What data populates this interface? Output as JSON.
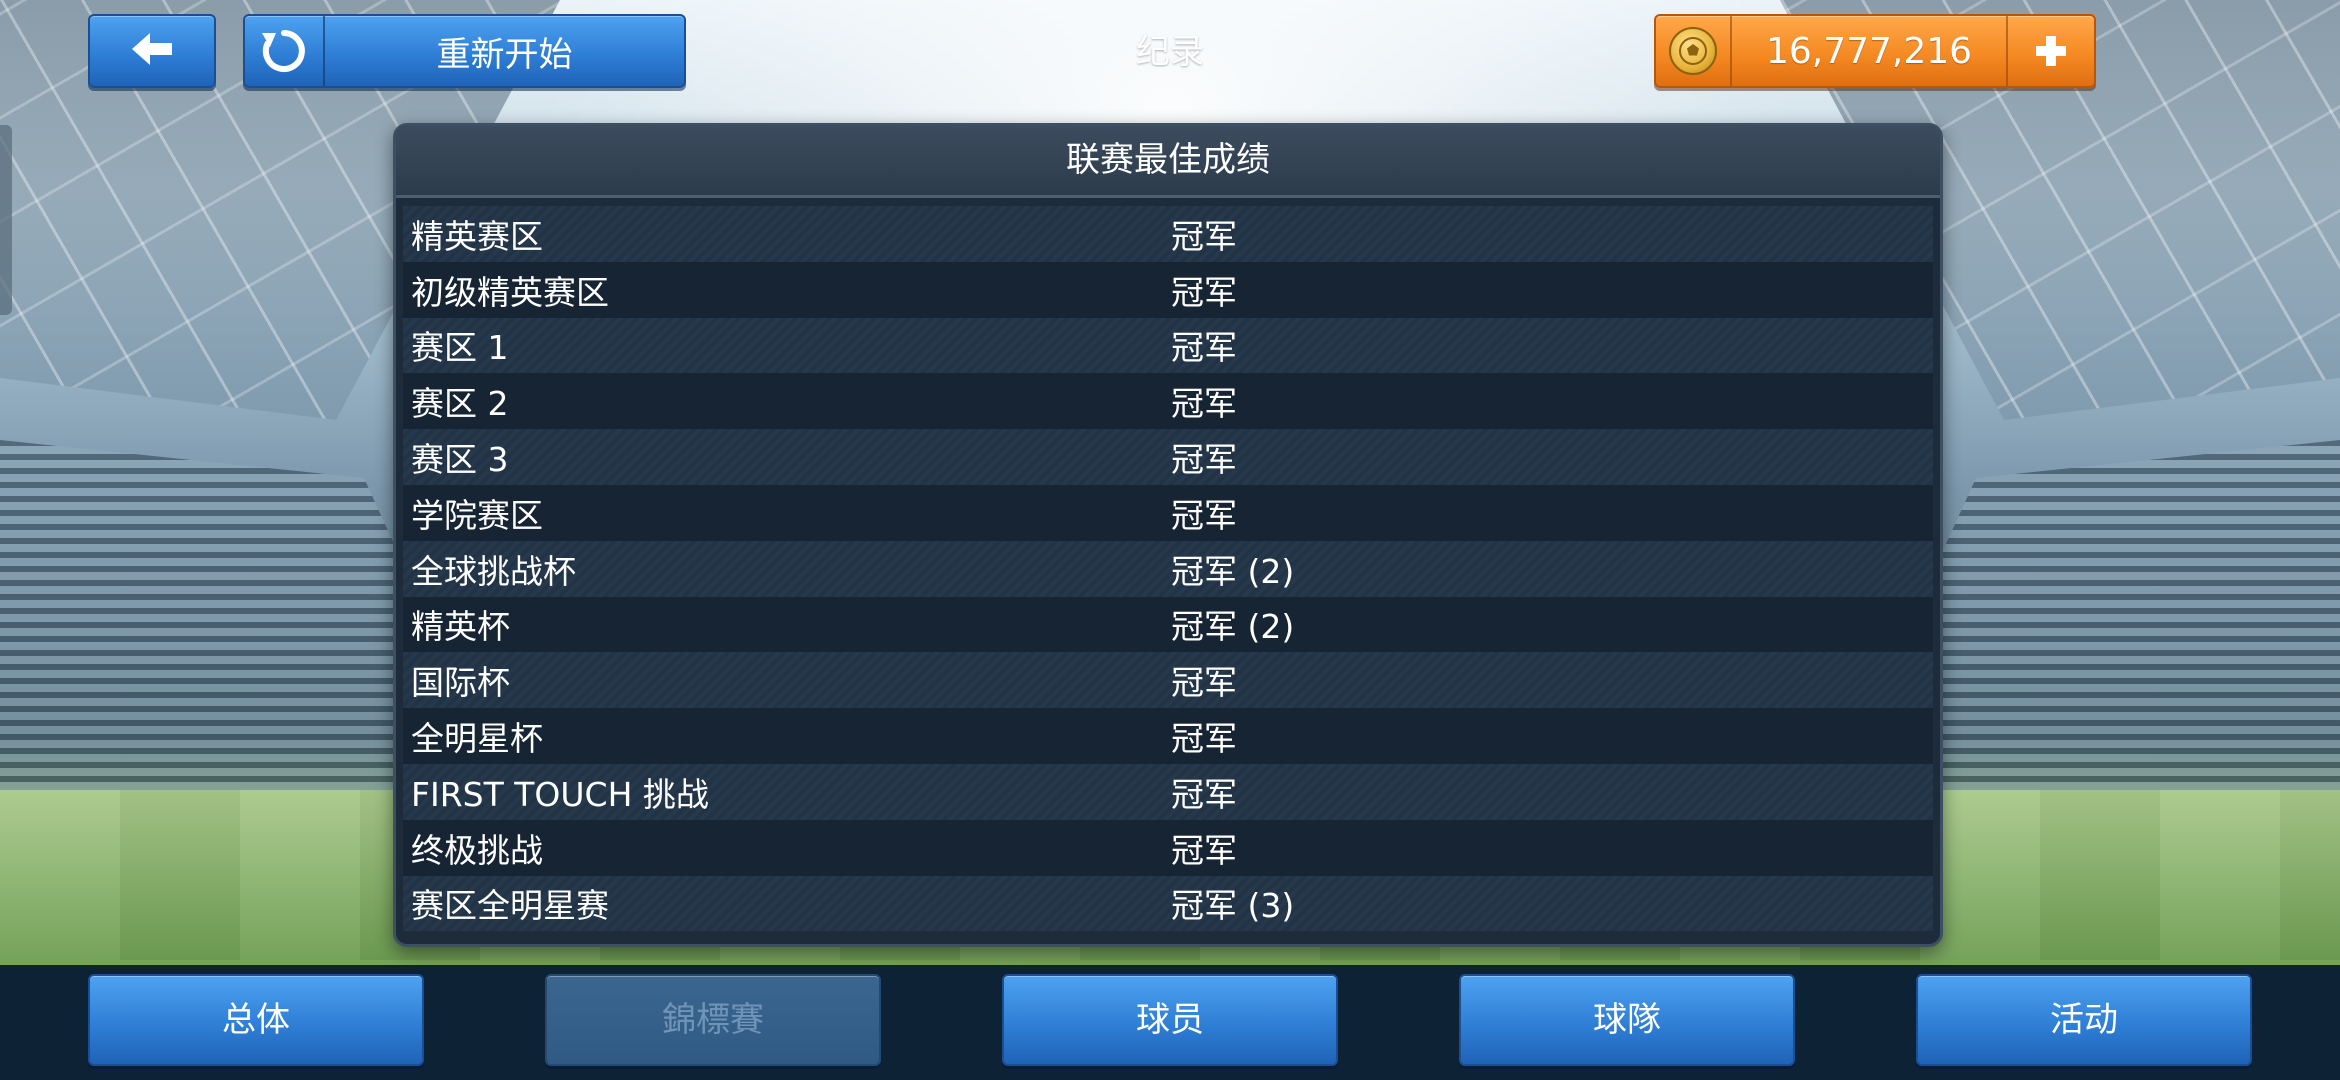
{
  "header": {
    "back_icon": "arrow-left-icon",
    "restart_label": "重新开始",
    "restart_icon": "restart-icon",
    "title": "纪录",
    "coins": "16,777,216",
    "coin_icon": "coin-icon",
    "add_icon": "plus-icon"
  },
  "panel": {
    "title": "联赛最佳成绩",
    "rows": [
      {
        "name": "精英赛区",
        "result": "冠军"
      },
      {
        "name": "初级精英赛区",
        "result": "冠军"
      },
      {
        "name": "赛区 1",
        "result": "冠军"
      },
      {
        "name": "赛区 2",
        "result": "冠军"
      },
      {
        "name": "赛区 3",
        "result": "冠军"
      },
      {
        "name": "学院赛区",
        "result": "冠军"
      },
      {
        "name": "全球挑战杯",
        "result": "冠军 (2)"
      },
      {
        "name": "精英杯",
        "result": "冠军 (2)"
      },
      {
        "name": "国际杯",
        "result": "冠军"
      },
      {
        "name": "全明星杯",
        "result": "冠军"
      },
      {
        "name": "FIRST TOUCH 挑战",
        "result": "冠军"
      },
      {
        "name": "终极挑战",
        "result": "冠军"
      },
      {
        "name": "赛区全明星赛",
        "result": "冠军 (3)"
      }
    ]
  },
  "nav": {
    "tabs": [
      {
        "label": "总体",
        "enabled": true
      },
      {
        "label": "錦標賽",
        "enabled": false
      },
      {
        "label": "球员",
        "enabled": true
      },
      {
        "label": "球隊",
        "enabled": true
      },
      {
        "label": "活动",
        "enabled": true
      }
    ]
  },
  "colors": {
    "button_blue": "#2f7fd6",
    "coin_orange": "#f58a23",
    "panel_bg": "#1d2b3a",
    "bottom_bar": "#0e2236"
  }
}
